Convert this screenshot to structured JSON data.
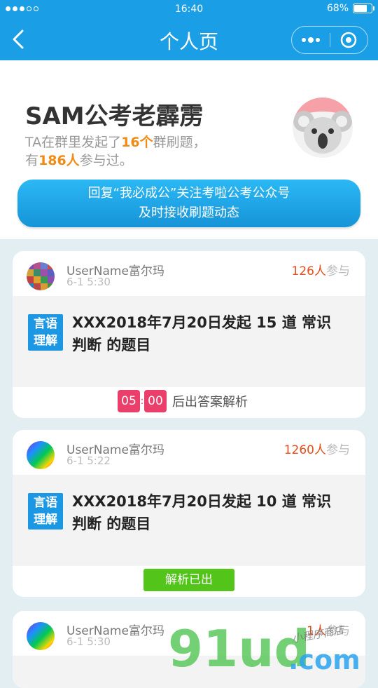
{
  "status_bar": {
    "time": "16:40",
    "battery": "68%"
  },
  "nav": {
    "title": "个人页"
  },
  "profile": {
    "name": "SAM公考老霹雳",
    "line1_prefix": "TA在群里发起了",
    "line1_count": "16个",
    "line1_suffix": "群刷题，",
    "line2_prefix": "有",
    "line2_count": "186人",
    "line2_suffix": "参与过。"
  },
  "follow_button": {
    "line1": "回复“我必成公”关注考啦公考公众号",
    "line2": "及时接收刷题动态"
  },
  "cards": [
    {
      "username": "UserName富尔玛",
      "time": "6-1  5:30",
      "count": "126人",
      "count_suffix": "参与",
      "tag_line1": "言语",
      "tag_line2": "理解",
      "question": "XXX2018年7月20日发起 15 道 常识判断 的题目",
      "timer_min": "05",
      "timer_sec": "00",
      "timer_label": "后出答案解析"
    },
    {
      "username": "UserName富尔玛",
      "time": "6-1  5:22",
      "count": "1260人",
      "count_suffix": "参与",
      "tag_line1": "言语",
      "tag_line2": "理解",
      "question": "XXX2018年7月20日发起 10 道 常识判断 的题目",
      "action": "解析已出"
    },
    {
      "username": "UserName富尔玛",
      "time": "6-1  5:30",
      "count": "1人",
      "count_suffix": "参与"
    }
  ],
  "watermark": {
    "main": "91ud",
    "dot": ".com",
    "tag": "小程序商店"
  },
  "colors": {
    "primary": "#1a9ee6",
    "accent": "#f08b16",
    "count_red": "#e54d1b",
    "timer": "#ea3f6a",
    "green": "#52c41a"
  }
}
